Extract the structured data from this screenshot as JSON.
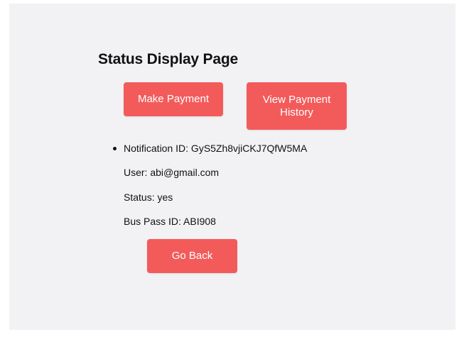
{
  "page": {
    "title": "Status Display Page"
  },
  "actions": {
    "make_payment_label": "Make Payment",
    "view_history_label": "View Payment History",
    "go_back_label": "Go Back"
  },
  "notification": {
    "id_label": "Notification ID: GyS5Zh8vjiCKJ7QfW5MA",
    "user_label": "User: abi@gmail.com",
    "status_label": "Status: yes",
    "bus_pass_label": "Bus Pass ID: ABI908"
  },
  "colors": {
    "button_bg": "#f35b5b",
    "panel_bg": "#f2f2f4"
  }
}
